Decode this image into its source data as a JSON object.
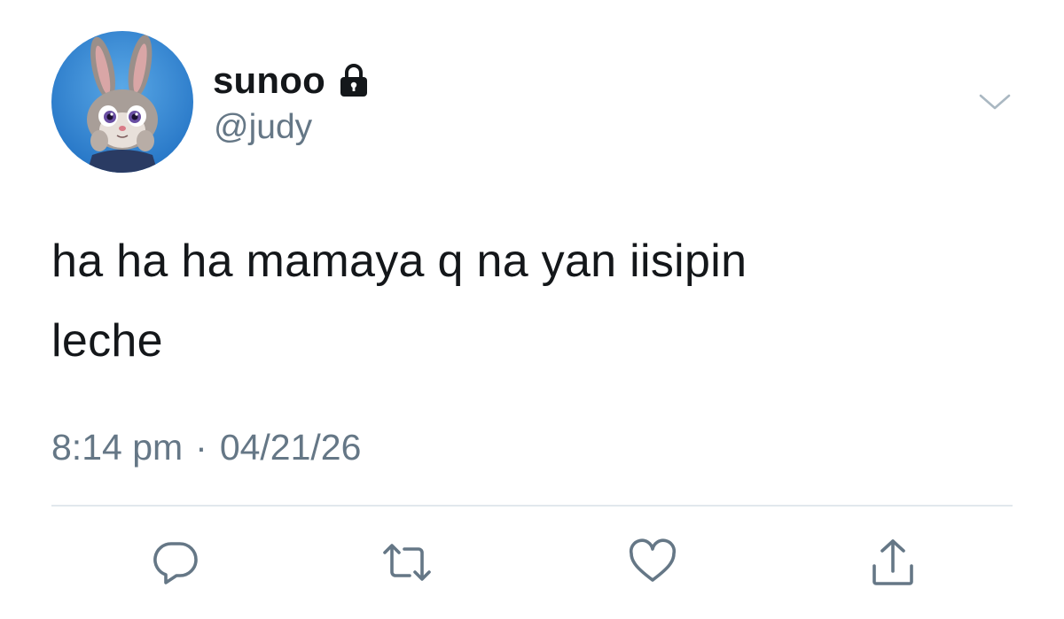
{
  "tweet": {
    "display_name": "sunoo",
    "handle": "@judy",
    "protected_icon": "lock-icon",
    "avatar_icon": "bunny-avatar",
    "text_line1": "ha ha ha mamaya q na yan iisipin",
    "text_line2": "leche",
    "time": "8:14 pm",
    "separator": "·",
    "date": "04/21/26"
  },
  "actions": [
    {
      "name": "reply",
      "icon": "speech-bubble-icon"
    },
    {
      "name": "retweet",
      "icon": "retweet-icon"
    },
    {
      "name": "like",
      "icon": "heart-icon"
    },
    {
      "name": "share",
      "icon": "share-icon"
    }
  ],
  "menu_icon": "chevron-down-icon",
  "colors": {
    "text": "#14171a",
    "secondary": "#657786",
    "icon": "#657786",
    "divider": "#e1e8ed",
    "caret": "#aab8c2"
  }
}
